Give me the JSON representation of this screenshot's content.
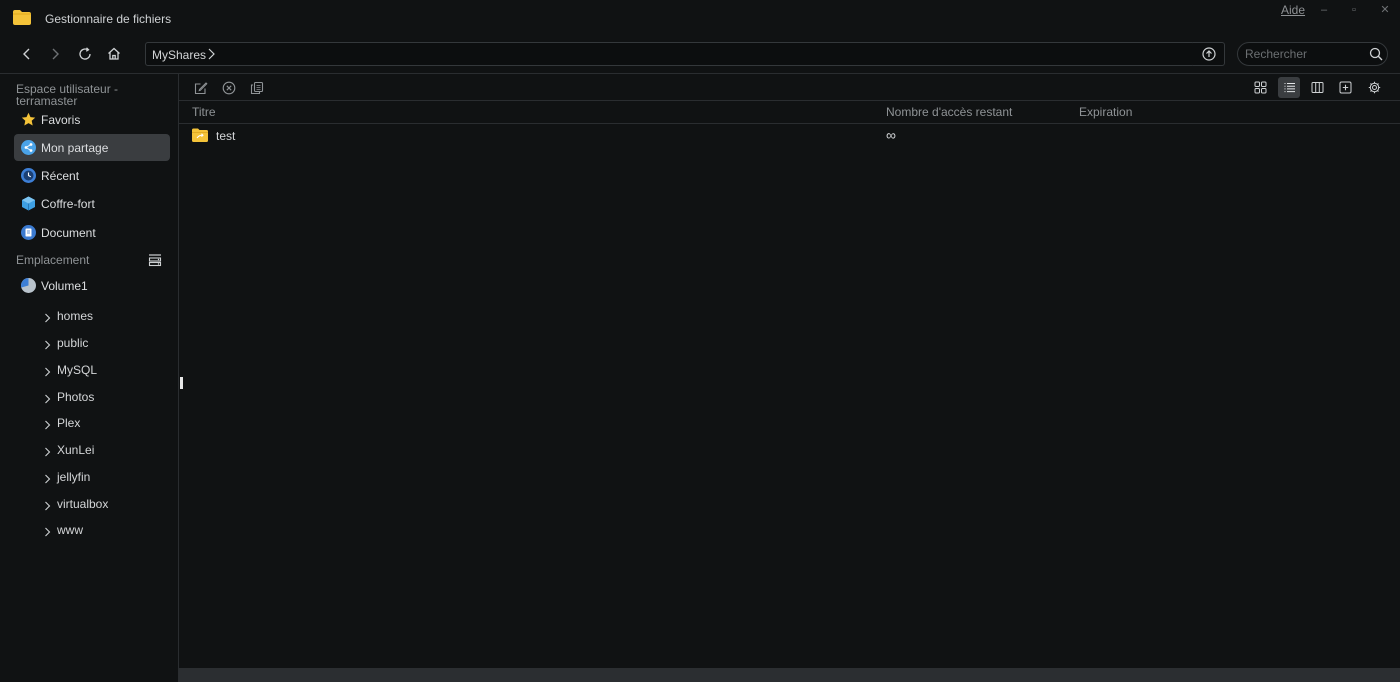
{
  "titlebar": {
    "title": "Gestionnaire de fichiers",
    "help": "Aide"
  },
  "navbar": {
    "path": "MyShares",
    "search_placeholder": "Rechercher"
  },
  "sidebar": {
    "user_section": "Espace utilisateur - terramaster",
    "items": [
      {
        "label": "Favoris",
        "icon": "star-icon",
        "active": false
      },
      {
        "label": "Mon partage",
        "icon": "share-icon",
        "active": true
      },
      {
        "label": "Récent",
        "icon": "clock-icon",
        "active": false
      },
      {
        "label": "Coffre-fort",
        "icon": "safe-icon",
        "active": false
      },
      {
        "label": "Document",
        "icon": "document-icon",
        "active": false
      }
    ],
    "location_section": "Emplacement",
    "volume": "Volume1",
    "folders": [
      "homes",
      "public",
      "MySQL",
      "Photos",
      "Plex",
      "XunLei",
      "jellyfin",
      "virtualbox",
      "www"
    ]
  },
  "table": {
    "columns": [
      "Titre",
      "Nombre d'accès restant",
      "Expiration"
    ],
    "rows": [
      {
        "title": "test",
        "access": "∞",
        "expiration": ""
      }
    ]
  },
  "colors": {
    "background": "#101213",
    "active_item": "#3a3d40",
    "folder": "#f4c339",
    "accent_blue": "#3d8fe0"
  }
}
